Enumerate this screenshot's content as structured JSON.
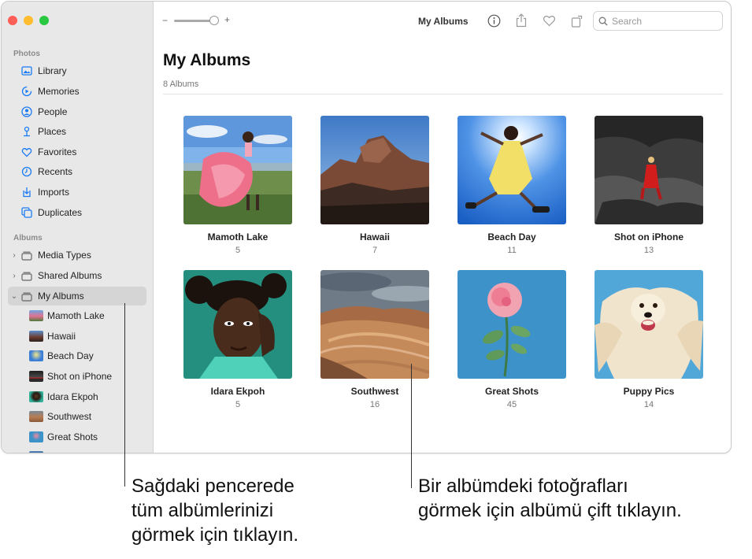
{
  "window": {
    "title": "My Albums",
    "search_placeholder": "Search"
  },
  "sidebar": {
    "photos_label": "Photos",
    "photos_items": [
      {
        "label": "Library",
        "icon": "library-icon"
      },
      {
        "label": "Memories",
        "icon": "memories-icon"
      },
      {
        "label": "People",
        "icon": "people-icon"
      },
      {
        "label": "Places",
        "icon": "places-icon"
      },
      {
        "label": "Favorites",
        "icon": "heart-icon"
      },
      {
        "label": "Recents",
        "icon": "clock-icon"
      },
      {
        "label": "Imports",
        "icon": "imports-icon"
      },
      {
        "label": "Duplicates",
        "icon": "duplicates-icon"
      }
    ],
    "albums_label": "Albums",
    "album_groups": [
      {
        "label": "Media Types",
        "expanded": false
      },
      {
        "label": "Shared Albums",
        "expanded": false
      },
      {
        "label": "My Albums",
        "expanded": true,
        "selected": true
      }
    ],
    "my_albums": [
      "Mamoth Lake",
      "Hawaii",
      "Beach Day",
      "Shot on iPhone",
      "Idara Ekpoh",
      "Southwest",
      "Great Shots"
    ]
  },
  "main": {
    "title": "My Albums",
    "count_label": "8 Albums",
    "albums": [
      {
        "name": "Mamoth Lake",
        "count": "5"
      },
      {
        "name": "Hawaii",
        "count": "7"
      },
      {
        "name": "Beach Day",
        "count": "11"
      },
      {
        "name": "Shot on iPhone",
        "count": "13"
      },
      {
        "name": "Idara Ekpoh",
        "count": "5"
      },
      {
        "name": "Southwest",
        "count": "16"
      },
      {
        "name": "Great Shots",
        "count": "45"
      },
      {
        "name": "Puppy Pics",
        "count": "14"
      }
    ]
  },
  "callouts": {
    "left": "Sağdaki pencerede\ntüm albümlerinizi\ngörmek için tıklayın.",
    "right": "Bir albümdeki fotoğrafları\ngörmek için albümü çift tıklayın."
  },
  "colors": {
    "sidebar_bg": "#e9e8e8",
    "accent": "#1a7cf5"
  }
}
